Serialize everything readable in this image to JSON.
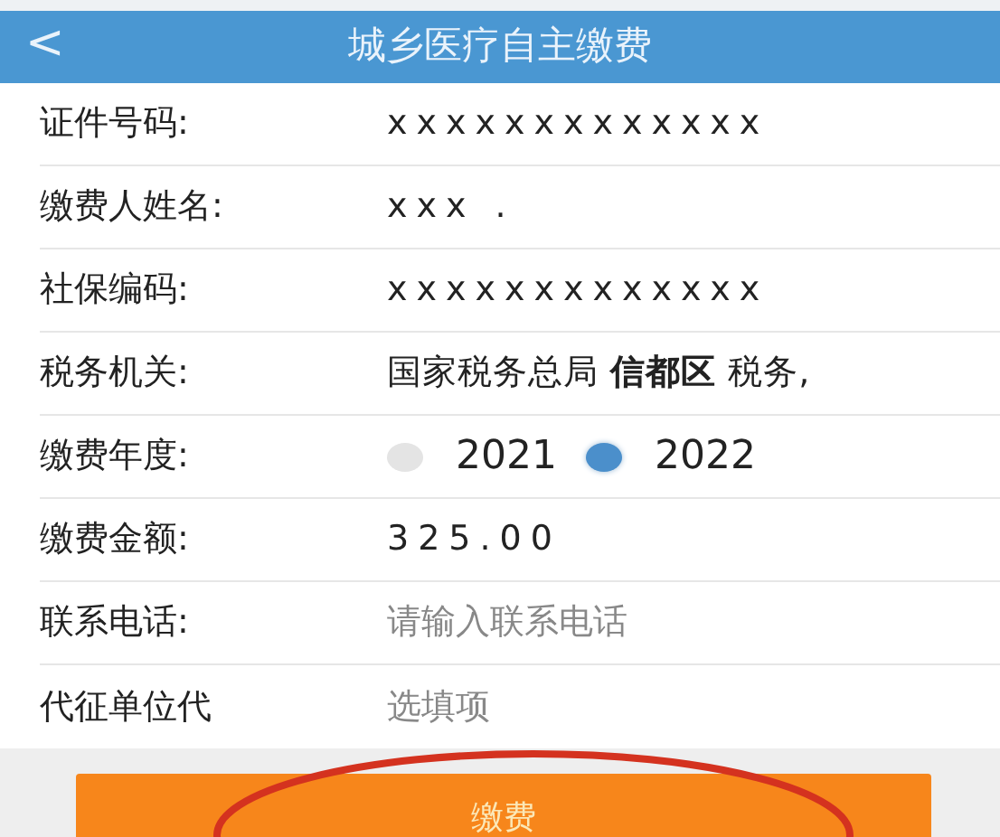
{
  "header": {
    "back": "<",
    "title": "城乡医疗自主缴费"
  },
  "fields": [
    {
      "kind": "text",
      "label": "证件号码:",
      "value": "xxxxxxxxxxxxx"
    },
    {
      "kind": "text",
      "label": "缴费人姓名:",
      "value": "xxx  ."
    },
    {
      "kind": "text",
      "label": "社保编码:",
      "value": "xxxxxxxxxxxxx"
    },
    {
      "kind": "rich",
      "label": "税务机关:",
      "value": "国家税务总局 **信都区** 税务,"
    },
    {
      "kind": "radio",
      "label": "缴费年度:",
      "options": [
        {
          "label": "2021",
          "selected": false
        },
        {
          "label": "2022",
          "selected": true
        }
      ]
    },
    {
      "kind": "text",
      "label": "缴费金额:",
      "value": "325.00"
    },
    {
      "kind": "input",
      "label": "联系电话:",
      "placeholder": "请输入联系电话"
    },
    {
      "kind": "input",
      "label": "代征单位代",
      "placeholder": "选填项"
    }
  ],
  "pay_button": "缴费"
}
